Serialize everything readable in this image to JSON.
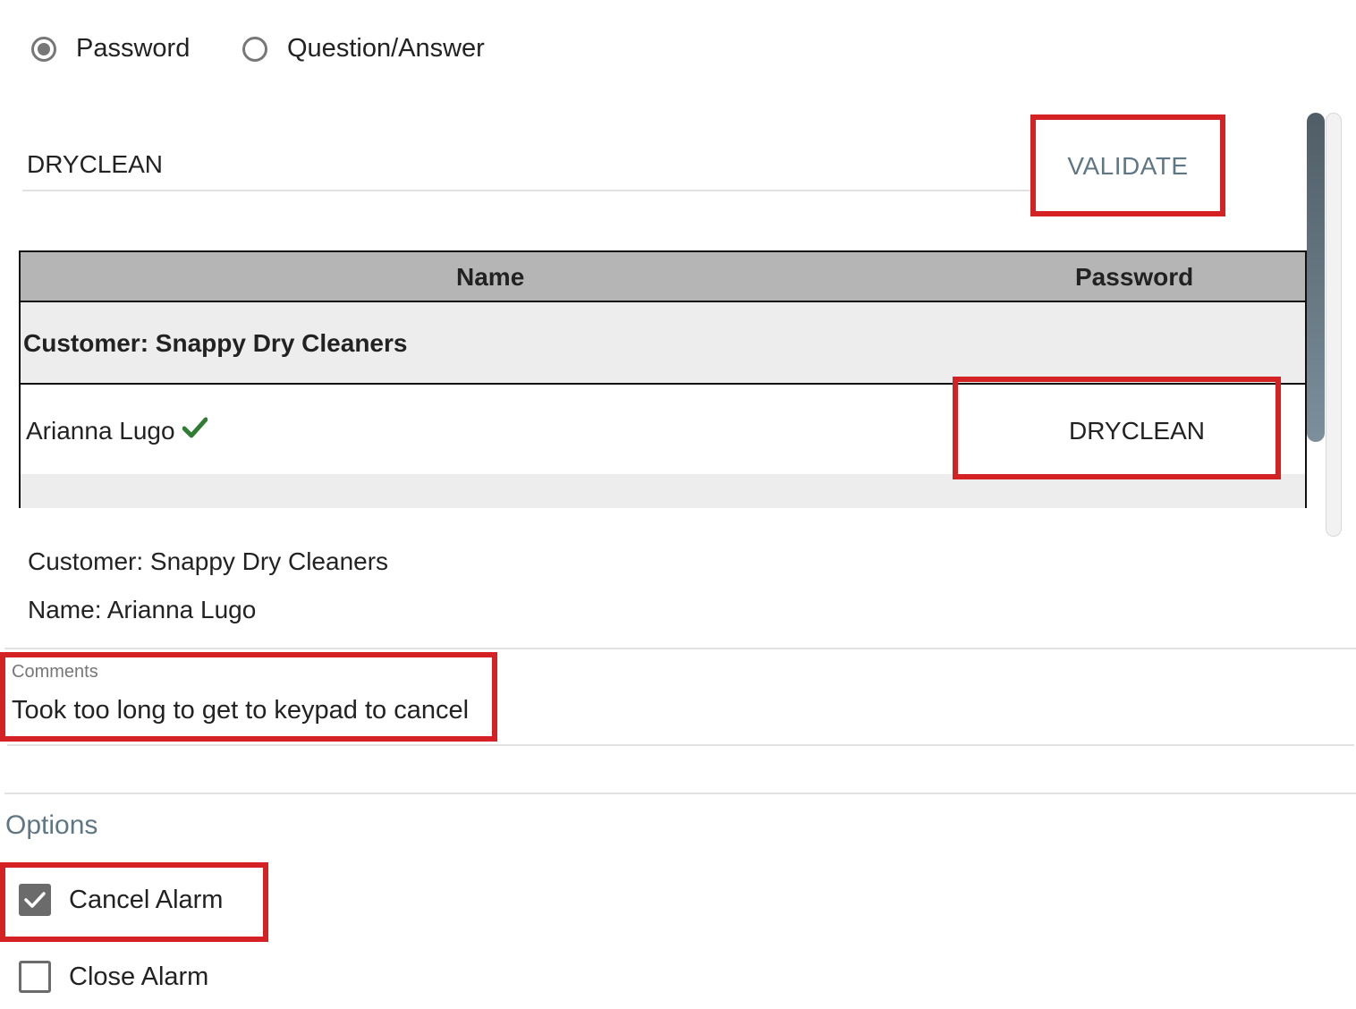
{
  "auth_mode": {
    "options": [
      {
        "label": "Password",
        "selected": true
      },
      {
        "label": "Question/Answer",
        "selected": false
      }
    ]
  },
  "password_field": {
    "value": "DRYCLEAN"
  },
  "validate_button": {
    "label": "VALIDATE"
  },
  "table": {
    "columns": [
      "Name",
      "Password"
    ],
    "group_label": "Customer: Snappy Dry Cleaners",
    "rows": [
      {
        "name": "Arianna Lugo",
        "verified": true,
        "password": "DRYCLEAN"
      }
    ]
  },
  "selection_info": {
    "customer": "Customer: Snappy Dry Cleaners",
    "name": "Name: Arianna Lugo"
  },
  "comments": {
    "label": "Comments",
    "value": "Took too long to get to keypad to cancel"
  },
  "options": {
    "title": "Options",
    "items": [
      {
        "label": "Cancel Alarm",
        "checked": true
      },
      {
        "label": "Close Alarm",
        "checked": false
      }
    ]
  },
  "colors": {
    "highlight": "#d32124",
    "accent": "#5f7684",
    "check_green": "#2e7d32",
    "header_gray": "#b5b5b5"
  }
}
